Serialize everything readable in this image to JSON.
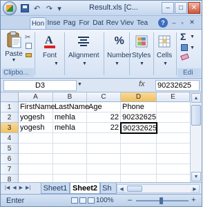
{
  "window": {
    "title": "Result.xls [C...",
    "accent": "#1e395b"
  },
  "quick_access": {
    "undo_glyph": "↶",
    "redo_glyph": "↷",
    "customize_glyph": "▾"
  },
  "window_controls": {
    "minimize": "–",
    "restore": "□",
    "close": "✕"
  },
  "ribbon_tabs": [
    "Hon",
    "Inse",
    "Pag",
    "For",
    "Dat",
    "Rev",
    "Viev",
    "Tea"
  ],
  "ribbon_active_tab": 0,
  "ribbon_groups": {
    "clipboard": {
      "label": "Clipbo...",
      "paste": "Paste"
    },
    "font": {
      "label": "Font"
    },
    "alignment": {
      "label": "Alignment"
    },
    "number": {
      "label": "Number",
      "glyph": "%"
    },
    "styles": {
      "label": "Styles"
    },
    "cells": {
      "label": "Cells"
    },
    "editing": {
      "label": "Edi",
      "sigma": "Σ"
    }
  },
  "formula_bar": {
    "name_box": "D3",
    "fx": "fx",
    "value": "90232625"
  },
  "columns": [
    "A",
    "B",
    "C",
    "D",
    "E"
  ],
  "selected_column": "D",
  "rows": [
    "1",
    "2",
    "3",
    "4",
    "5",
    "6",
    "7",
    "8"
  ],
  "selected_row": "3",
  "cells": {
    "A1": "FirstName",
    "B1": "LastName",
    "C1": "Age",
    "D1": "Phone",
    "A2": "yogesh",
    "B2": "mehla",
    "C2": "22",
    "D2": "90232625",
    "A3": "yogesh",
    "B3": "mehla",
    "C3": "22",
    "D3": "90232625"
  },
  "sheet_tabs": [
    "Sheet1",
    "Sheet2",
    "Sh"
  ],
  "active_sheet": 1,
  "status": {
    "mode": "Enter",
    "zoom": "100%"
  }
}
